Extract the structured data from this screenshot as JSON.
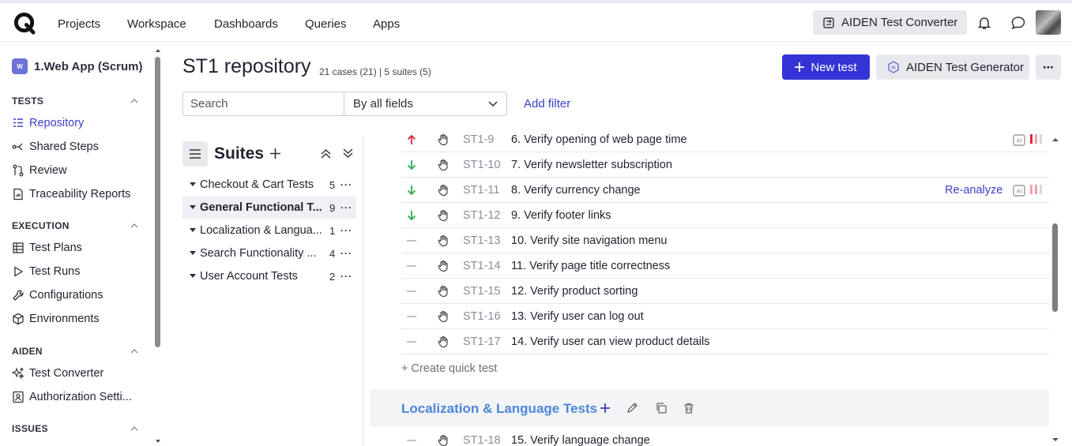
{
  "topbar": {
    "nav": [
      "Projects",
      "Workspace",
      "Dashboards",
      "Queries",
      "Apps"
    ],
    "converter_label": "AIDEN Test Converter"
  },
  "sidebar": {
    "project_badge": "W",
    "project_name": "1.Web App (Scrum)",
    "sections": {
      "tests": "TESTS",
      "execution": "EXECUTION",
      "aiden": "AIDEN",
      "issues": "ISSUES"
    },
    "tests_items": [
      "Repository",
      "Shared Steps",
      "Review",
      "Traceability Reports"
    ],
    "execution_items": [
      "Test Plans",
      "Test Runs",
      "Configurations",
      "Environments"
    ],
    "aiden_items": [
      "Test Converter",
      "Authorization Setti..."
    ]
  },
  "header": {
    "title": "ST1 repository",
    "meta": "21 cases (21) | 5 suites (5)",
    "new_test": "New test",
    "generator": "AIDEN Test Generator",
    "more": "⋯"
  },
  "filter": {
    "search_placeholder": "Search",
    "fields_value": "By all fields",
    "add_filter": "Add filter"
  },
  "suites": {
    "title": "Suites",
    "items": [
      {
        "name": "Checkout & Cart Tests",
        "count": "5"
      },
      {
        "name": "General Functional T...",
        "count": "9"
      },
      {
        "name": "Localization & Langua...",
        "count": "1"
      },
      {
        "name": "Search Functionality ...",
        "count": "4"
      },
      {
        "name": "User Account Tests",
        "count": "2"
      }
    ]
  },
  "cases": [
    {
      "id": "ST1-9",
      "title": "6. Verify opening of web page time",
      "priority": "high"
    },
    {
      "id": "ST1-10",
      "title": "7. Verify newsletter subscription",
      "priority": "low"
    },
    {
      "id": "ST1-11",
      "title": "8. Verify currency change",
      "priority": "low",
      "action": "Re-analyze"
    },
    {
      "id": "ST1-12",
      "title": "9. Verify footer links",
      "priority": "low"
    },
    {
      "id": "ST1-13",
      "title": "10. Verify site navigation menu",
      "priority": "normal"
    },
    {
      "id": "ST1-14",
      "title": "11. Verify page title correctness",
      "priority": "normal"
    },
    {
      "id": "ST1-15",
      "title": "12. Verify product sorting",
      "priority": "normal"
    },
    {
      "id": "ST1-16",
      "title": "13. Verify user can log out",
      "priority": "normal"
    },
    {
      "id": "ST1-17",
      "title": "14. Verify user can view product details",
      "priority": "normal"
    }
  ],
  "quick_create": "+ Create quick test",
  "group": {
    "title": "Localization & Language Tests",
    "first_case": {
      "id": "ST1-18",
      "title": "15. Verify language change",
      "priority": "normal"
    }
  },
  "colors": {
    "accent": "#3434d6",
    "priority_high": "#e0243b",
    "priority_low": "#2fa84f",
    "group_title": "#4c86d8"
  }
}
